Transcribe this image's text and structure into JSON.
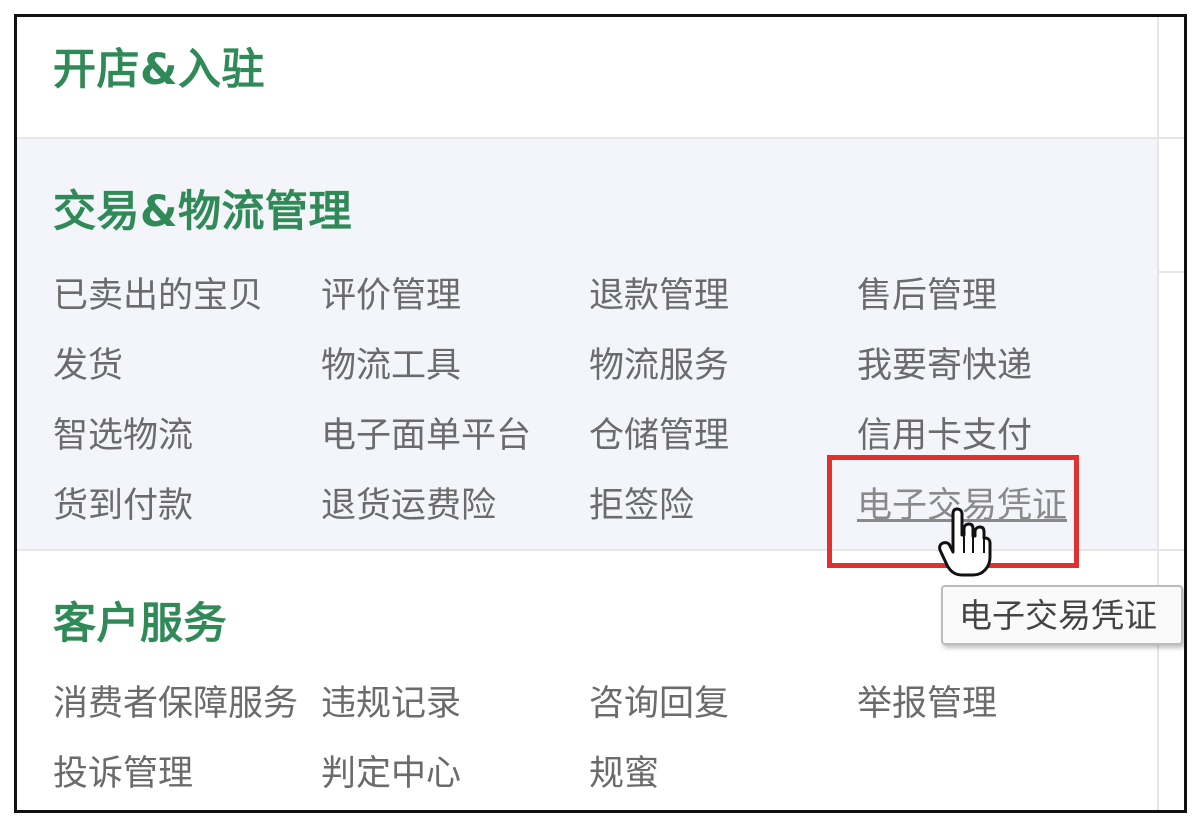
{
  "sections": [
    {
      "title": "开店&入驻"
    },
    {
      "title": "交易&物流管理"
    },
    {
      "title": "客户服务"
    }
  ],
  "trade_items": [
    [
      "已卖出的宝贝",
      "评价管理",
      "退款管理",
      "售后管理"
    ],
    [
      "发货",
      "物流工具",
      "物流服务",
      "我要寄快递"
    ],
    [
      "智选物流",
      "电子面单平台",
      "仓储管理",
      "信用卡支付"
    ],
    [
      "货到付款",
      "退货运费险",
      "拒签险",
      "电子交易凭证"
    ]
  ],
  "service_items": [
    [
      "消费者保障服务",
      "违规记录",
      "咨询回复",
      "举报管理"
    ],
    [
      "投诉管理",
      "判定中心",
      "规蜜"
    ]
  ],
  "tooltip": "电子交易凭证",
  "colors": {
    "title": "#2f8a57",
    "highlight": "#e03131"
  }
}
